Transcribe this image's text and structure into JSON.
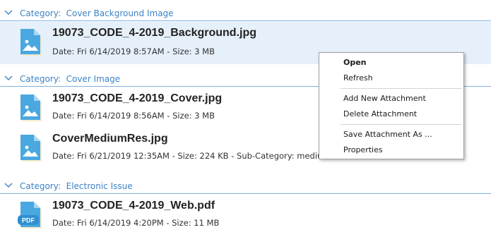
{
  "categories": [
    {
      "label": "Category:  Cover Background Image",
      "items": [
        {
          "name": "19073_CODE_4-2019_Background.jpg",
          "meta": "Date: Fri 6/14/2019 8:57AM - Size: 3 MB",
          "icon": "image-file-icon",
          "selected": true
        }
      ]
    },
    {
      "label": "Category:  Cover Image",
      "items": [
        {
          "name": "19073_CODE_4-2019_Cover.jpg",
          "meta": "Date: Fri 6/14/2019 8:56AM - Size: 3 MB",
          "icon": "image-file-icon"
        },
        {
          "name": "CoverMediumRes.jpg",
          "meta": "Date: Fri 6/21/2019 12:35AM - Size: 224 KB - Sub-Category: medium resolution",
          "icon": "image-file-icon"
        }
      ]
    },
    {
      "label": "Category:  Electronic Issue",
      "items": [
        {
          "name": "19073_CODE_4-2019_Web.pdf",
          "meta": "Date: Fri 6/14/2019 4:20PM - Size: 11 MB",
          "icon": "pdf-file-icon",
          "icon_text": "PDF"
        }
      ]
    }
  ],
  "context_menu": {
    "items": [
      {
        "label": "Open",
        "default": true
      },
      {
        "label": "Refresh"
      },
      {
        "label": "Add New Attachment"
      },
      {
        "label": "Delete Attachment"
      },
      {
        "label": "Save Attachment As ..."
      },
      {
        "label": "Properties"
      }
    ]
  },
  "colors": {
    "accent": "#3c83c4",
    "divider": "#7fb0de",
    "selection": "#e6f0fb",
    "icon_fill": "#4aa8e0",
    "icon_fold": "#a6d7f4",
    "icon_shadow": "#f5e6b8"
  }
}
